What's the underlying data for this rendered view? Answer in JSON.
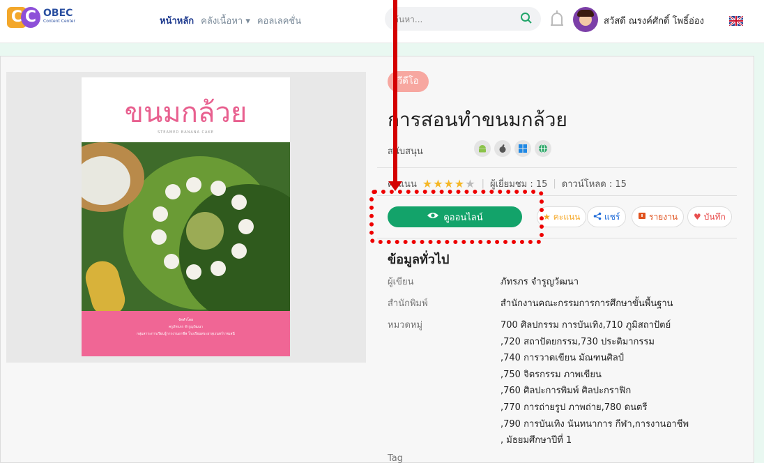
{
  "navbar": {
    "logo_letters": "CC",
    "logo_brand": "OBEC",
    "logo_sub": "Content Center",
    "links": [
      {
        "label": "หน้าหลัก"
      },
      {
        "label": "คลังเนื้อหา ▾"
      },
      {
        "label": "คอลเลคชั่น"
      }
    ],
    "search_placeholder": "ค้นหา...",
    "user_name": "สวัสดี ณรงค์ศักดิ์ โพธิ์อ่อง",
    "icons": {
      "search": "search-icon",
      "bell": "bell-icon",
      "flag": "uk-flag-icon"
    }
  },
  "cover": {
    "title": "ขนมกล้วย",
    "subtitle": "STEAMED BANANA CAKE",
    "footer_lines": [
      "จัดทำโดย",
      "ครูภัทรภร จำรูญวัฒนา",
      "กลุ่มสาระการเรียนรู้การงานอาชีพ โรงเรียนพระยาสุเรนทร์ราชเสนี"
    ]
  },
  "detail": {
    "tag": "วีดีโอ",
    "title": "การสอนทำขนมกล้วย",
    "support_label": "สนับสนุน",
    "platforms": [
      "android-icon",
      "apple-icon",
      "windows-icon",
      "web-icon"
    ],
    "rating_label": "คะแนน",
    "rating_stars": 4,
    "views": "ผู้เยี่ยมชม : 15",
    "downloads": "ดาวน์โหลด : 15",
    "view_button": "ดูออนไลน์",
    "rate_button": "คะแนน",
    "share_button": "แชร์",
    "report_button": "รายงาน",
    "save_button": "บันทึก"
  },
  "info": {
    "heading": "ข้อมูลทั่วไป",
    "author_label": "ผู้เขียน",
    "author": "ภัทรภร จำรูญวัฒนา",
    "publisher_label": "สำนักพิมพ์",
    "publisher": "สำนักงานคณะกรรมการการศึกษาขั้นพื้นฐาน",
    "category_label": "หมวดหมู่",
    "category_lines": [
      "700 ศิลปกรรม การบันเทิง,710 ภูมิสถาปัตย์",
      ",720 สถาปัตยกรรม,730 ประติมากรรม",
      ",740 การวาดเขียน มัณฑนศิลป์",
      ",750 จิตรกรรม ภาพเขียน",
      ",760 ศิลปะการพิมพ์ ศิลปะกราฟิก",
      ",770 การถ่ายรูป ภาพถ่าย,780 ดนตรี",
      ",790 การบันเทิง นันทนาการ กีฬา,การงานอาชีพ",
      ", มัธยมศึกษาปีที่ 1"
    ],
    "tag_label": "Tag"
  }
}
